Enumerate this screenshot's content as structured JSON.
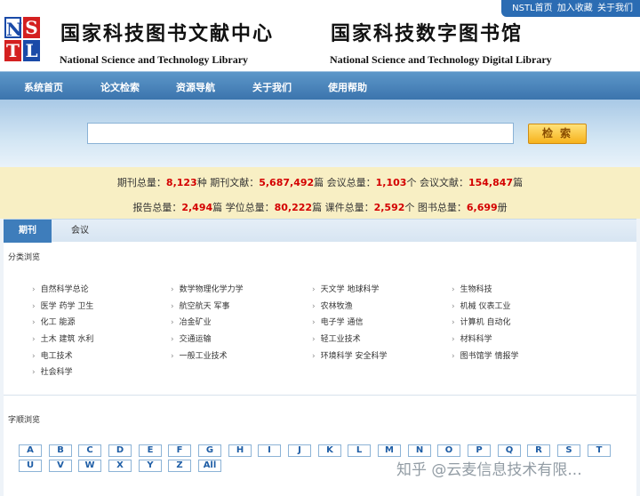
{
  "toplinks": {
    "home": "NSTL首页",
    "favorite": "加入收藏",
    "about": "关于我们"
  },
  "logo": {
    "c1": "N",
    "c2": "S",
    "c3": "T",
    "c4": "L"
  },
  "header": {
    "cn_title_1": "国家科技图书文献中心",
    "cn_title_2": "国家科技数字图书馆",
    "en_title_1": "National Science and Technology Library",
    "en_title_2": "National Science and Technology Digital Library"
  },
  "nav": [
    "系统首页",
    "论文检索",
    "资源导航",
    "关于我们",
    "使用帮助"
  ],
  "search": {
    "value": "",
    "button": "检索"
  },
  "stats": {
    "line1": [
      {
        "label": "期刊总量：",
        "value": "8,123",
        "unit": "种"
      },
      {
        "label": "期刊文献：",
        "value": "5,687,492",
        "unit": "篇"
      },
      {
        "label": "会议总量：",
        "value": "1,103",
        "unit": "个"
      },
      {
        "label": "会议文献：",
        "value": "154,847",
        "unit": "篇"
      }
    ],
    "line2": [
      {
        "label": "报告总量：",
        "value": "2,494",
        "unit": "篇"
      },
      {
        "label": "学位总量：",
        "value": "80,222",
        "unit": "篇"
      },
      {
        "label": "课件总量：",
        "value": "2,592",
        "unit": "个"
      },
      {
        "label": "图书总量：",
        "value": "6,699",
        "unit": "册"
      }
    ]
  },
  "tabs": [
    "期刊",
    "会议"
  ],
  "category_title": "分类浏览",
  "categories": [
    [
      "自然科学总论",
      "数学物理化学力学",
      "天文学 地球科学",
      "生物科技"
    ],
    [
      "医学 药学 卫生",
      "航空航天 军事",
      "农林牧渔",
      "机械 仪表工业"
    ],
    [
      "化工 能源",
      "冶金矿业",
      "电子学 通信",
      "计算机 自动化"
    ],
    [
      "土木 建筑 水利",
      "交通运输",
      "轻工业技术",
      "材料科学"
    ],
    [
      "电工技术",
      "一般工业技术",
      "环境科学 安全科学",
      "图书馆学 情报学"
    ],
    [
      "社会科学"
    ]
  ],
  "alpha_title": "字顺浏览",
  "letters_row1": [
    "A",
    "B",
    "C",
    "D",
    "E",
    "F",
    "G",
    "H",
    "I",
    "J",
    "K",
    "L",
    "M",
    "N",
    "O",
    "P",
    "Q",
    "R",
    "S",
    "T"
  ],
  "letters_row2": [
    "U",
    "V",
    "W",
    "X",
    "Y",
    "Z",
    "All"
  ],
  "watermark": "知乎 @云麦信息技术有限..."
}
